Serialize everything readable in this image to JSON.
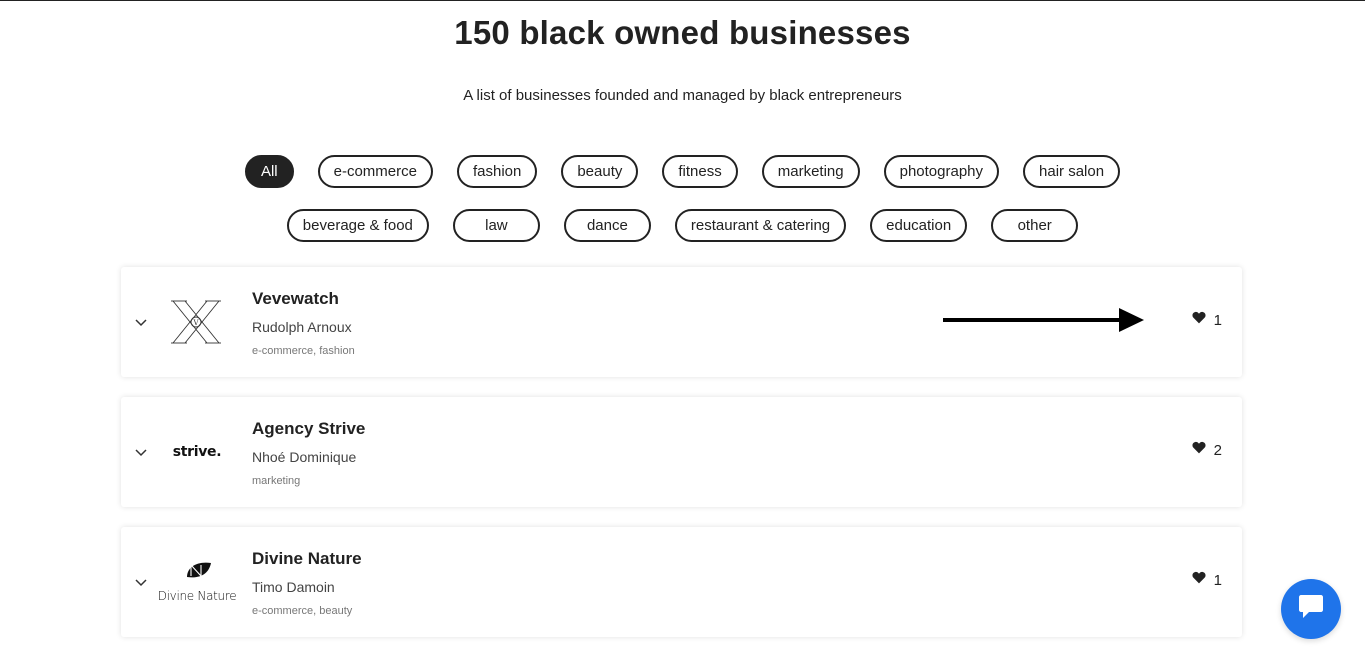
{
  "header": {
    "title": "150 black owned businesses",
    "subtitle": "A list of businesses founded and managed by black entrepreneurs"
  },
  "filters": {
    "row1": [
      "All",
      "e-commerce",
      "fashion",
      "beauty",
      "fitness",
      "marketing",
      "photography",
      "hair salon"
    ],
    "row2": [
      "beverage & food",
      "law",
      "dance",
      "restaurant & catering",
      "education",
      "other"
    ],
    "active": "All"
  },
  "businesses": [
    {
      "name": "Vevewatch",
      "owner": "Rudolph Arnoux",
      "categories": "e-commerce, fashion",
      "likes": "1",
      "logo": "vevewatch-logo"
    },
    {
      "name": "Agency Strive",
      "owner": "Nhoé Dominique",
      "categories": "marketing",
      "likes": "2",
      "logo": "strive-logo",
      "logo_text": "strive."
    },
    {
      "name": "Divine Nature",
      "owner": "Timo Damoin",
      "categories": "e-commerce, beauty",
      "likes": "1",
      "logo": "divine-nature-logo",
      "logo_text": "Divine Nature"
    }
  ],
  "icons": {
    "expand": "chevron-down-icon",
    "like": "heart-icon",
    "annotation": "arrow-right-icon",
    "chat": "chat-icon"
  },
  "colors": {
    "text": "#222222",
    "active_chip_bg": "#222222",
    "chat_button": "#1f74ea"
  }
}
